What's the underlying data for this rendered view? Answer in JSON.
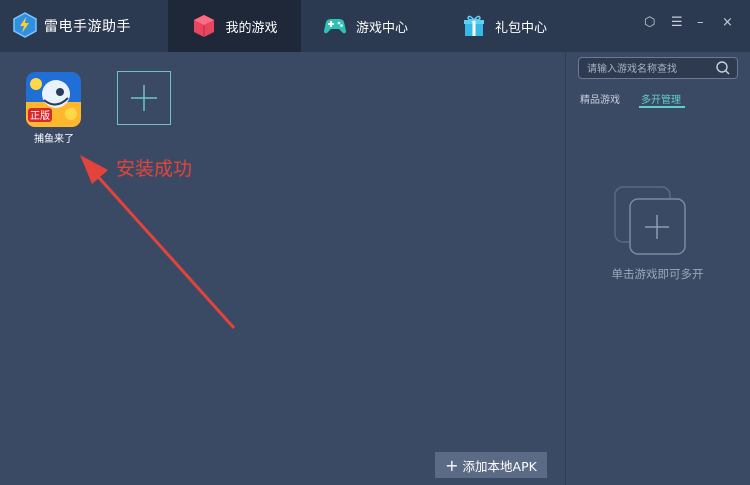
{
  "app": {
    "title": "雷电手游助手",
    "logo_icon": "lightning-bolt-icon"
  },
  "tabs": [
    {
      "label": "我的游戏",
      "icon": "game-box-icon",
      "active": true
    },
    {
      "label": "游戏中心",
      "icon": "gamepad-icon",
      "active": false
    },
    {
      "label": "礼包中心",
      "icon": "gift-icon",
      "active": false
    }
  ],
  "window_controls": {
    "skin": "⬡",
    "menu": "☰",
    "minimize": "–",
    "close": "×"
  },
  "games": [
    {
      "name": "捕鱼来了",
      "icon_badge": "正版"
    }
  ],
  "add_game_icon": "plus-icon",
  "annotation": "安装成功",
  "add_apk_label": "添加本地APK",
  "right_panel": {
    "search_placeholder": "请输入游戏名称查找",
    "tabs": [
      {
        "label": "精品游戏",
        "active": false
      },
      {
        "label": "多开管理",
        "active": true
      }
    ],
    "empty_text": "单击游戏即可多开"
  },
  "colors": {
    "accent": "#5fd0c9",
    "annotation": "#e2443c",
    "background": "#3b4a64",
    "topbar": "#2c3a51"
  }
}
